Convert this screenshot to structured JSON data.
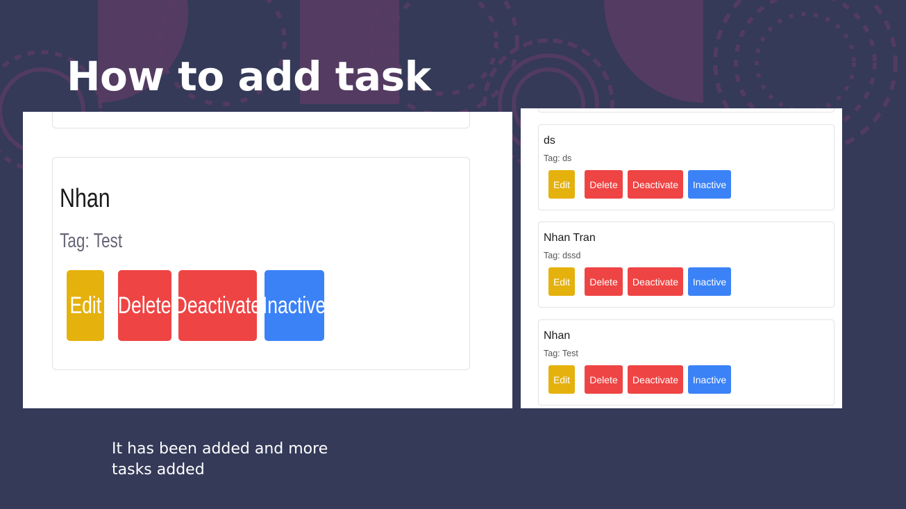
{
  "slide": {
    "title": "How to add task",
    "caption": "It has been added and more tasks added"
  },
  "colors": {
    "background": "#343a58",
    "edit": "#e5b10c",
    "delete": "#ef4444",
    "deactivate": "#ef4444",
    "inactive": "#3b82f6"
  },
  "zoomed_task": {
    "title": "Nhan",
    "tag": "Tag: Test",
    "buttons": {
      "edit": "Edit",
      "delete": "Delete",
      "deactivate": "Deactivate",
      "inactive": "Inactive"
    }
  },
  "task_list": [
    {
      "title": "ds",
      "tag": "Tag: ds",
      "buttons": {
        "edit": "Edit",
        "delete": "Delete",
        "deactivate": "Deactivate",
        "inactive": "Inactive"
      }
    },
    {
      "title": "Nhan Tran",
      "tag": "Tag: dssd",
      "buttons": {
        "edit": "Edit",
        "delete": "Delete",
        "deactivate": "Deactivate",
        "inactive": "Inactive"
      }
    },
    {
      "title": "Nhan",
      "tag": "Tag: Test",
      "buttons": {
        "edit": "Edit",
        "delete": "Delete",
        "deactivate": "Deactivate",
        "inactive": "Inactive"
      }
    }
  ]
}
